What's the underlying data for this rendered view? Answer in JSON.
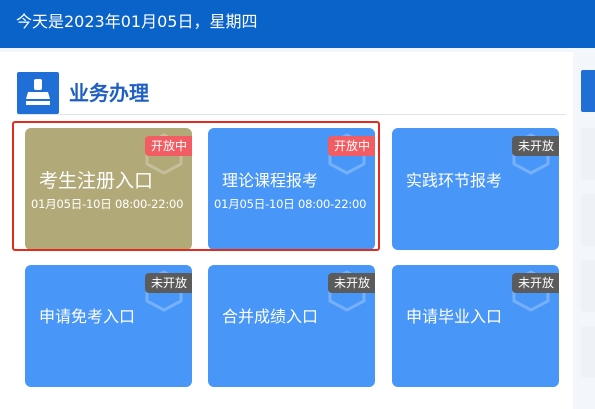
{
  "header": {
    "date_text": "今天是2023年01月05日，星期四"
  },
  "section": {
    "title": "业务办理",
    "icon": "stamp-icon"
  },
  "colors": {
    "header_bg": "#0a63c9",
    "card_blue": "#4896f7",
    "card_selected": "#b2a978",
    "badge_open": "#f25c63",
    "badge_closed": "#5b5b5b",
    "highlight_border": "#e22a1f",
    "section_title": "#1f5fc4"
  },
  "cards": [
    {
      "title": "考生注册入口",
      "status": "开放中",
      "time": "01月05日-10日 08:00-22:00"
    },
    {
      "title": "理论课程报考",
      "status": "开放中",
      "time": "01月05日-10日 08:00-22:00"
    },
    {
      "title": "实践环节报考",
      "status": "未开放"
    },
    {
      "title": "申请免考入口",
      "status": "未开放"
    },
    {
      "title": "合并成绩入口",
      "status": "未开放"
    },
    {
      "title": "申请毕业入口",
      "status": "未开放"
    }
  ]
}
